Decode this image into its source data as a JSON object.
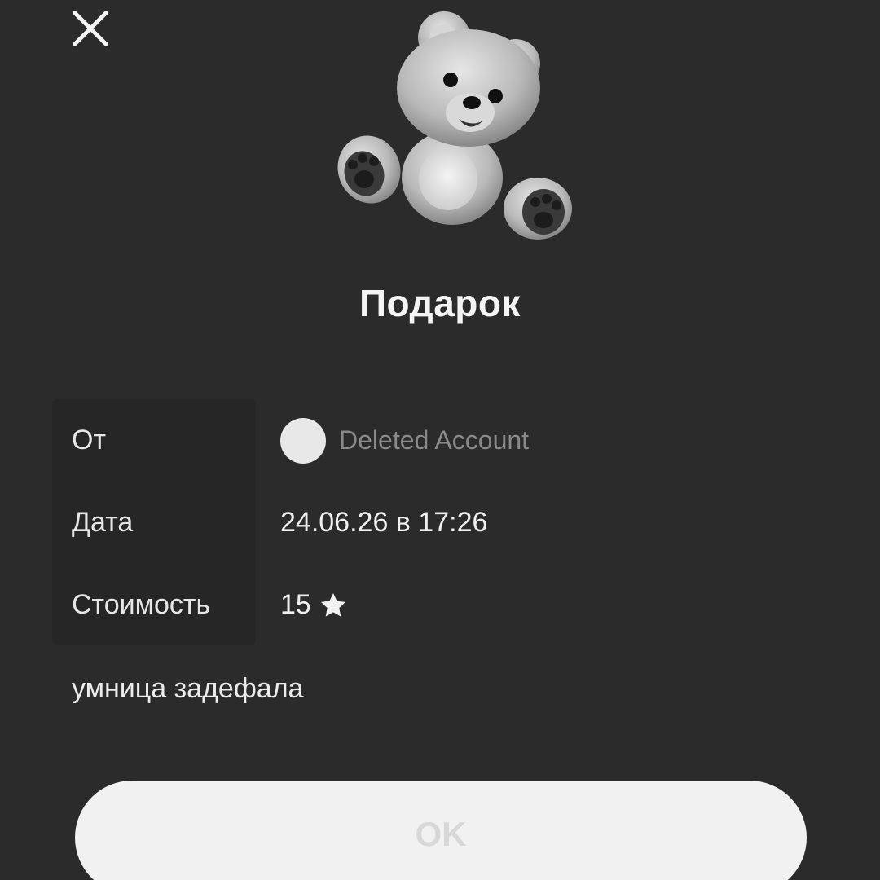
{
  "header": {
    "close_icon": "close-icon"
  },
  "gift": {
    "sticker": "teddy-bear",
    "title": "Подарок"
  },
  "details": {
    "rows": [
      {
        "label": "От",
        "value": "Deleted Account",
        "icon": "avatar"
      },
      {
        "label": "Дата",
        "value": "24.06.26 в 17:26"
      },
      {
        "label": "Стоимость",
        "value": "15",
        "icon": "star-icon"
      }
    ]
  },
  "message": "умница задефала",
  "actions": {
    "ok_label": "OK"
  },
  "colors": {
    "background": "#2b2b2b",
    "button": "#f1f1f1",
    "muted_text": "#8a8a8a"
  }
}
